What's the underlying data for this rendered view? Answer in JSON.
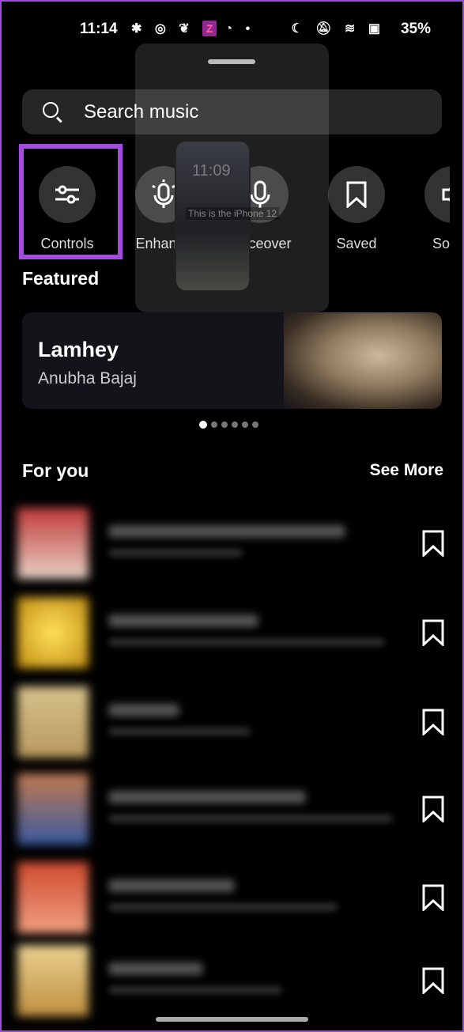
{
  "status_bar": {
    "time": "11:14",
    "battery": "35%",
    "notification_icons": [
      "slack-icon",
      "instagram-icon",
      "swiggy-icon",
      "zomato-icon",
      "recorder-icon",
      "dot-icon"
    ],
    "z_badge": "Z",
    "system_icons": [
      "moon-icon",
      "bell-off-icon",
      "wifi-icon",
      "x-icon",
      "battery-icon"
    ]
  },
  "preview": {
    "clock": "11:09",
    "caption": "This is the iPhone 12"
  },
  "search": {
    "placeholder": "Search music"
  },
  "tools": [
    {
      "label": "Controls",
      "icon": "sliders-icon"
    },
    {
      "label": "Enhance",
      "icon": "mic-sparkle-icon"
    },
    {
      "label": "Voiceover",
      "icon": "mic-icon"
    },
    {
      "label": "Saved",
      "icon": "bookmark-icon"
    },
    {
      "label": "Sound",
      "icon": "speaker-icon"
    }
  ],
  "highlight_color": "#a24be0",
  "featured": {
    "heading": "Featured",
    "title": "Lamhey",
    "artist": "Anubha Bajaj",
    "pages": 6,
    "active_page": 1
  },
  "for_you": {
    "heading": "For you",
    "see_more": "See More"
  }
}
